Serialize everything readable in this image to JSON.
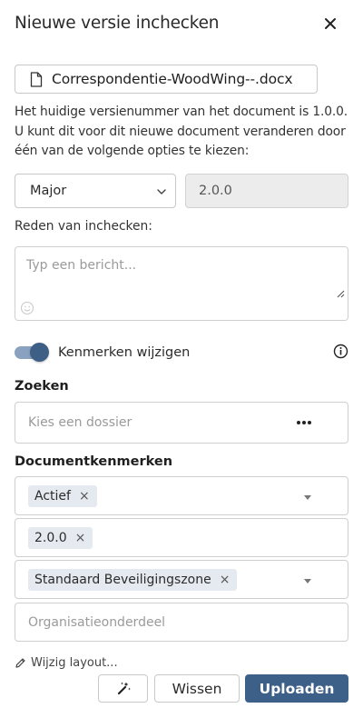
{
  "dialog": {
    "title": "Nieuwe versie inchecken",
    "close_icon": "close-icon"
  },
  "file": {
    "name": "Correspondentie-WoodWing--.docx",
    "icon": "document-icon"
  },
  "description": "Het huidige versienummer van het document is 1.0.0. U kunt dit voor dit nieuwe document veranderen door één van de volgende opties te kiezen:",
  "version": {
    "type_selected": "Major",
    "new_version": "2.0.0"
  },
  "reason": {
    "label": "Reden van inchecken:",
    "placeholder": "Typ een bericht..."
  },
  "properties_toggle": {
    "label": "Kenmerken wijzigen",
    "on": true
  },
  "search": {
    "title": "Zoeken",
    "placeholder": "Kies een dossier"
  },
  "document_properties": {
    "title": "Documentkenmerken",
    "status_tag": "Actief",
    "version_tag": "2.0.0",
    "security_tag": "Standaard Beveiligingszone",
    "org_unit_placeholder": "Organisatieonderdeel"
  },
  "footer": {
    "edit_layout": "Wijzig layout...",
    "clear_label": "Wissen",
    "upload_label": "Uploaden"
  },
  "colors": {
    "primary": "#3d6089",
    "toggle_track": "#8aa2bf",
    "tag_bg": "#e5eaf0"
  }
}
